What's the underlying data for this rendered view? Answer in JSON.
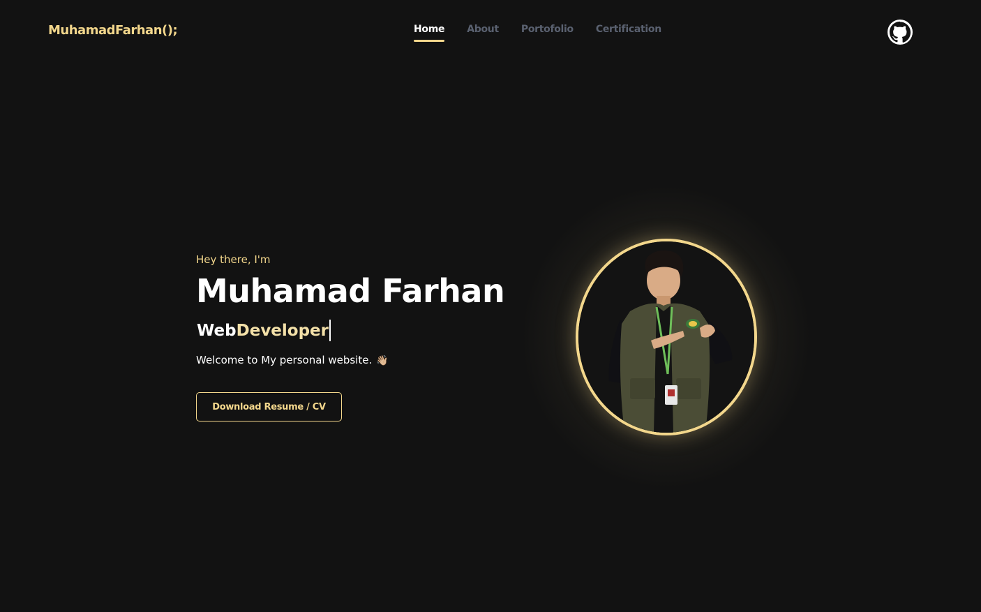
{
  "header": {
    "logo": "MuhamadFarhan();",
    "nav": [
      {
        "label": "Home",
        "active": true
      },
      {
        "label": "About",
        "active": false
      },
      {
        "label": "Portofolio",
        "active": false
      },
      {
        "label": "Certification",
        "active": false
      }
    ],
    "github_icon": "github-icon"
  },
  "hero": {
    "greeting": "Hey there, I'm",
    "name": "Muhamad Farhan",
    "role_prefix": "Web ",
    "role_typed": "Developer",
    "welcome": "Welcome to My personal website.",
    "wave_emoji": "👋🏼",
    "button_label": "Download Resume / CV"
  },
  "colors": {
    "background": "#121212",
    "accent": "#f3d78c",
    "nav_inactive": "#5a6170",
    "text": "#ffffff"
  }
}
